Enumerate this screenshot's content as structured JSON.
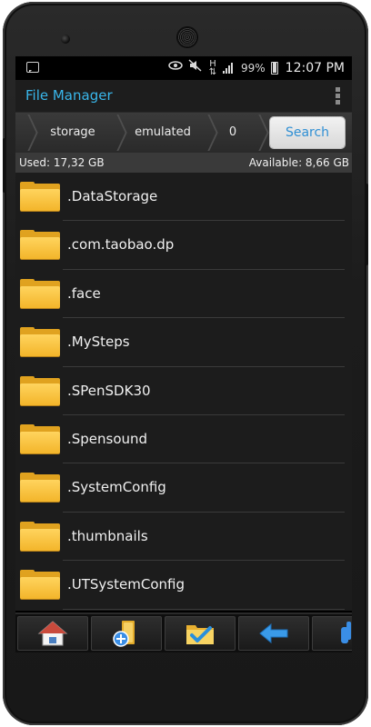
{
  "statusbar": {
    "battery_percent": "99%",
    "time": "12:07 PM",
    "icons": [
      "notification-icon",
      "eye-icon",
      "mute-icon",
      "hplus-icon",
      "signal-icon",
      "battery-icon"
    ]
  },
  "app": {
    "title": "File Manager",
    "accent_color": "#39b6ea"
  },
  "path": {
    "crumbs": [
      "storage",
      "emulated",
      "0"
    ],
    "search_label": "Search"
  },
  "storage": {
    "used": "Used: 17,32 GB",
    "available": "Available: 8,66 GB"
  },
  "files": [
    {
      "name": ".DataStorage",
      "icon": "folder-icon"
    },
    {
      "name": ".com.taobao.dp",
      "icon": "folder-icon"
    },
    {
      "name": ".face",
      "icon": "folder-icon"
    },
    {
      "name": ".MySteps",
      "icon": "folder-icon"
    },
    {
      "name": ".SPenSDK30",
      "icon": "folder-icon"
    },
    {
      "name": ".Spensound",
      "icon": "folder-icon"
    },
    {
      "name": ".SystemConfig",
      "icon": "folder-icon"
    },
    {
      "name": ".thumbnails",
      "icon": "folder-icon"
    },
    {
      "name": ".UTSystemConfig",
      "icon": "folder-icon"
    }
  ],
  "toolbar": {
    "buttons": [
      "home-icon",
      "new-folder-icon",
      "select-folder-icon",
      "back-arrow-icon",
      "hand-icon"
    ]
  }
}
